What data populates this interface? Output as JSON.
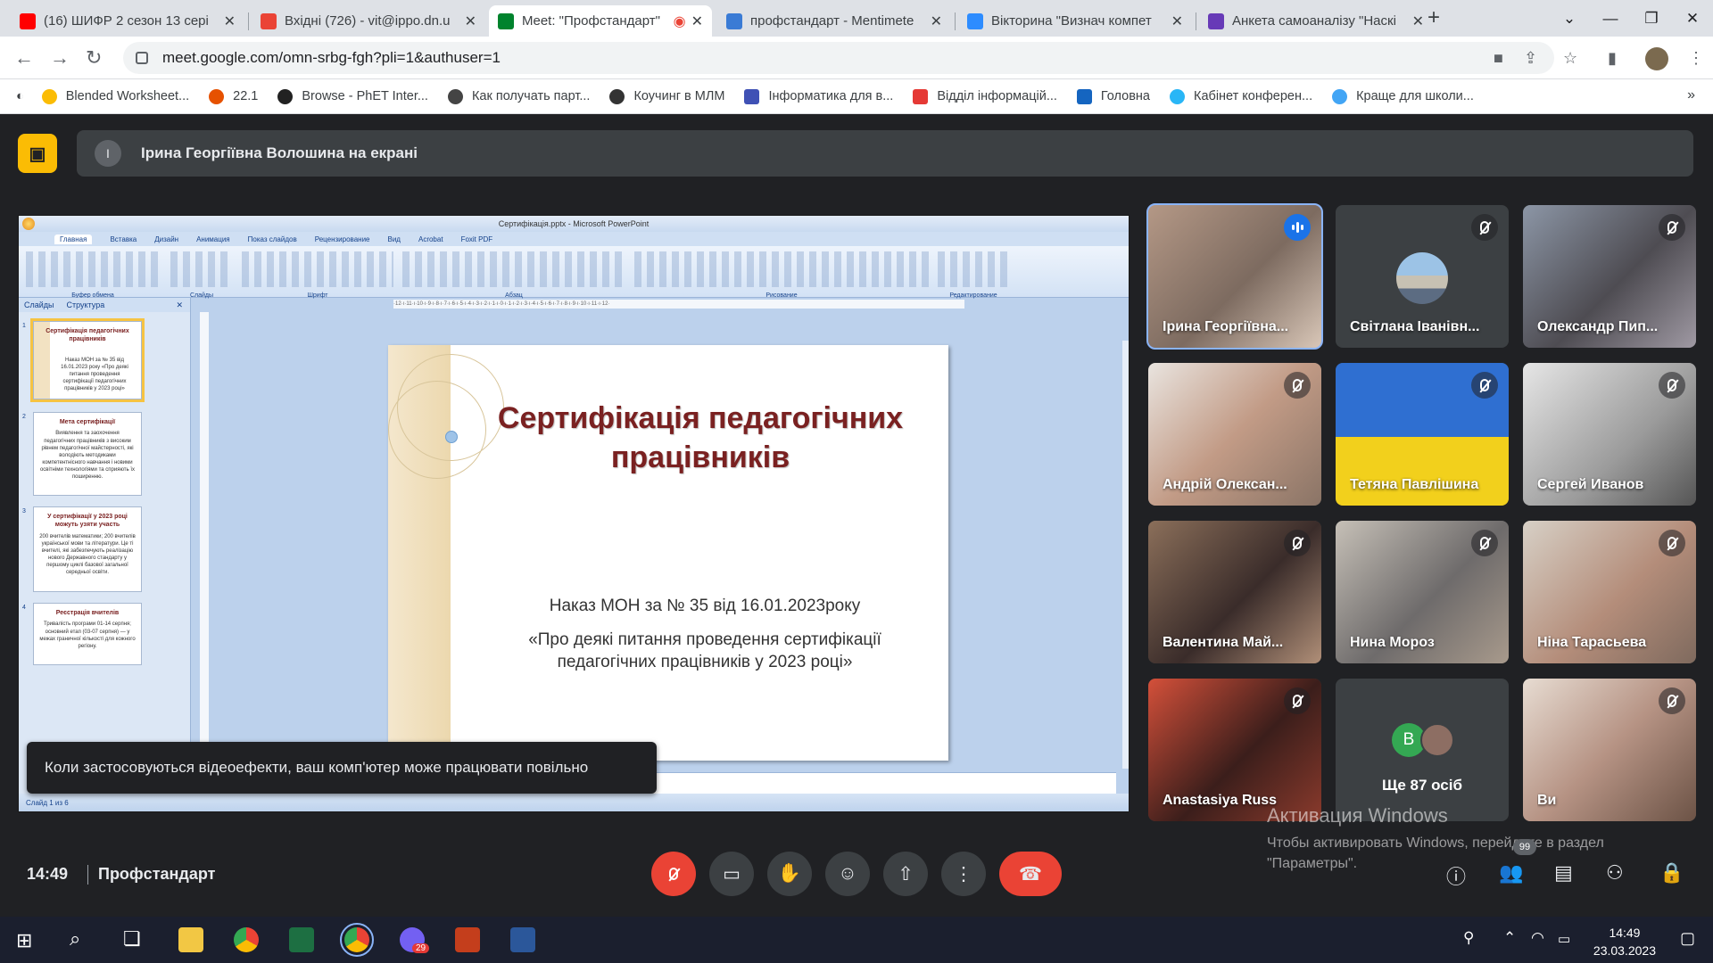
{
  "browser": {
    "tabs": [
      {
        "title": "(16) ШИФР 2 сезон 13 сері",
        "favicon_color": "#ff0000",
        "active": false
      },
      {
        "title": "Вхідні (726) - vit@ippo.dn.u",
        "favicon_color": "#ea4335",
        "active": false
      },
      {
        "title": "Meet: \"Профстандарт\"",
        "favicon_color": "#00832d",
        "active": true
      },
      {
        "title": "профстандарт - Mentimete",
        "favicon_color": "#3a7bd5",
        "active": false
      },
      {
        "title": "Вікторина \"Визнач компет",
        "favicon_color": "#2d8cff",
        "active": false
      },
      {
        "title": "Анкета самоаналізу \"Наскі",
        "favicon_color": "#673ab7",
        "active": false
      }
    ],
    "new_tab_label": "+",
    "url": "meet.google.com/omn-srbg-fgh?pli=1&authuser=1",
    "bookmarks": [
      {
        "label": "Blended Worksheet...",
        "color": "#fbbc04"
      },
      {
        "label": "22.1",
        "color": "#e65100"
      },
      {
        "label": "Browse - PhET Inter...",
        "color": "#222222"
      },
      {
        "label": "Как получать парт...",
        "color": "#444444"
      },
      {
        "label": "Коучинг в МЛМ",
        "color": "#333333"
      },
      {
        "label": "Інформатика для в...",
        "color": "#3f51b5"
      },
      {
        "label": "Відділ інформацій...",
        "color": "#e53935"
      },
      {
        "label": "Головна",
        "color": "#1565c0"
      },
      {
        "label": "Кабінет конферен...",
        "color": "#29b6f6"
      },
      {
        "label": "Краще для школи...",
        "color": "#42a5f5"
      }
    ],
    "bookmarks_overflow": "»"
  },
  "meet": {
    "presenter_initial": "І",
    "presenting_banner": "Ірина Георгіївна Волошина на екрані",
    "toast": "Коли застосовуються відеоефекти, ваш комп'ютер може працювати повільно",
    "time": "14:49",
    "meeting_name": "Профстандарт",
    "participants_badge": "99",
    "participants": [
      {
        "name": "Ірина Георгіївна...",
        "speaking": true,
        "bg": "linear-gradient(135deg,#b49886,#7d6b60 55%,#d9c7b8)"
      },
      {
        "name": "Світлана Іванівн...",
        "speaking": false,
        "bg": "#3c4043"
      },
      {
        "name": "Олександр Пип...",
        "speaking": false,
        "bg": "linear-gradient(135deg,#8c96a6,#4e4c52 55%,#9f99a3)"
      },
      {
        "name": "Андрій Олексан...",
        "speaking": false,
        "bg": "linear-gradient(135deg,#e9e4df,#c29b86 50%,#8a7466)"
      },
      {
        "name": "Тетяна Павлішина",
        "speaking": false,
        "bg": "linear-gradient(180deg,#2f6fd1 0 52%,#f2d01c 52%)"
      },
      {
        "name": "Сергей Иванов",
        "speaking": false,
        "bg": "linear-gradient(135deg,#e6e6e6,#9b9b9b 60%,#555)"
      },
      {
        "name": "Валентина Май...",
        "speaking": false,
        "bg": "linear-gradient(135deg,#8b6f5a,#3a2c2a 55%,#b08f78)"
      },
      {
        "name": "Нина Мороз",
        "speaking": false,
        "bg": "linear-gradient(135deg,#c6c0b7,#6e6b6b 55%,#a89a8c)"
      },
      {
        "name": "Ніна Тарасьева",
        "speaking": false,
        "bg": "linear-gradient(135deg,#d7d0c6,#b48d7a 55%,#7f6a5e)"
      },
      {
        "name": "Anastasiya Russ",
        "speaking": false,
        "bg": "linear-gradient(135deg,#d4503a,#3b1e1b 55%,#8a3a2c)"
      },
      {
        "name": "Ще 87 осіб",
        "speaking": false,
        "bg": "#3c4043"
      },
      {
        "name": "Ви",
        "speaking": false,
        "bg": "linear-gradient(135deg,#e7dcd2,#b69384 50%,#6c5346)"
      }
    ],
    "more_initial": "B"
  },
  "powerpoint": {
    "window_title": "Сертифікація.pptx - Microsoft PowerPoint",
    "ribbon_tabs": [
      "Главная",
      "Вставка",
      "Дизайн",
      "Анимация",
      "Показ слайдов",
      "Рецензирование",
      "Вид",
      "Acrobat",
      "Foxit PDF"
    ],
    "ribbon_groups": [
      "Буфер обмена",
      "Слайды",
      "Шрифт",
      "Абзац",
      "Рисование",
      "Редактирование"
    ],
    "panel_tabs": [
      "Слайды",
      "Структура"
    ],
    "thumbnails": [
      {
        "num": "1",
        "title": "Сертифікація педагогічних працівників",
        "text": "Наказ МОН за № 35 від 16.01.2023 року «Про деякі питання проведення сертифікації педагогічних працівників у 2023 році»"
      },
      {
        "num": "2",
        "title": "Мета сертифікації",
        "text": "Виявлення та заохочення педагогічних працівників з високим рівнем педагогічної майстерності, які володіють методиками компетентнісного навчання і новими освітніми технологіями та сприяють їх поширенню."
      },
      {
        "num": "3",
        "title": "У сертифікації у 2023 році можуть узяти участь",
        "text": "200 вчителів математики; 200 вчителів української мови та літератури. Це ті вчителі, які забезпечують реалізацію нового Державного стандарту у першому циклі базової загальної середньої освіти."
      },
      {
        "num": "4",
        "title": "Реєстрація вчителів",
        "text": "Тривалість програми 01-14 серпня; основний етап (03-07 серпня) — у межах граничної кількості для кожного регіону."
      }
    ],
    "slide_title": "Сертифікація педагогічних працівників",
    "slide_line1": "Наказ МОН за № 35 від 16.01.2023року",
    "slide_line2": "«Про деякі питання проведення сертифікації педагогічних працівників у 2023 році»",
    "status": "Слайд 1 из 6"
  },
  "windows": {
    "activation_title": "Активация Windows",
    "activation_text": "Чтобы активировать Windows, перейдите в раздел \"Параметры\".",
    "clock_time": "14:49",
    "clock_date": "23.03.2023",
    "viber_badge": "29"
  }
}
